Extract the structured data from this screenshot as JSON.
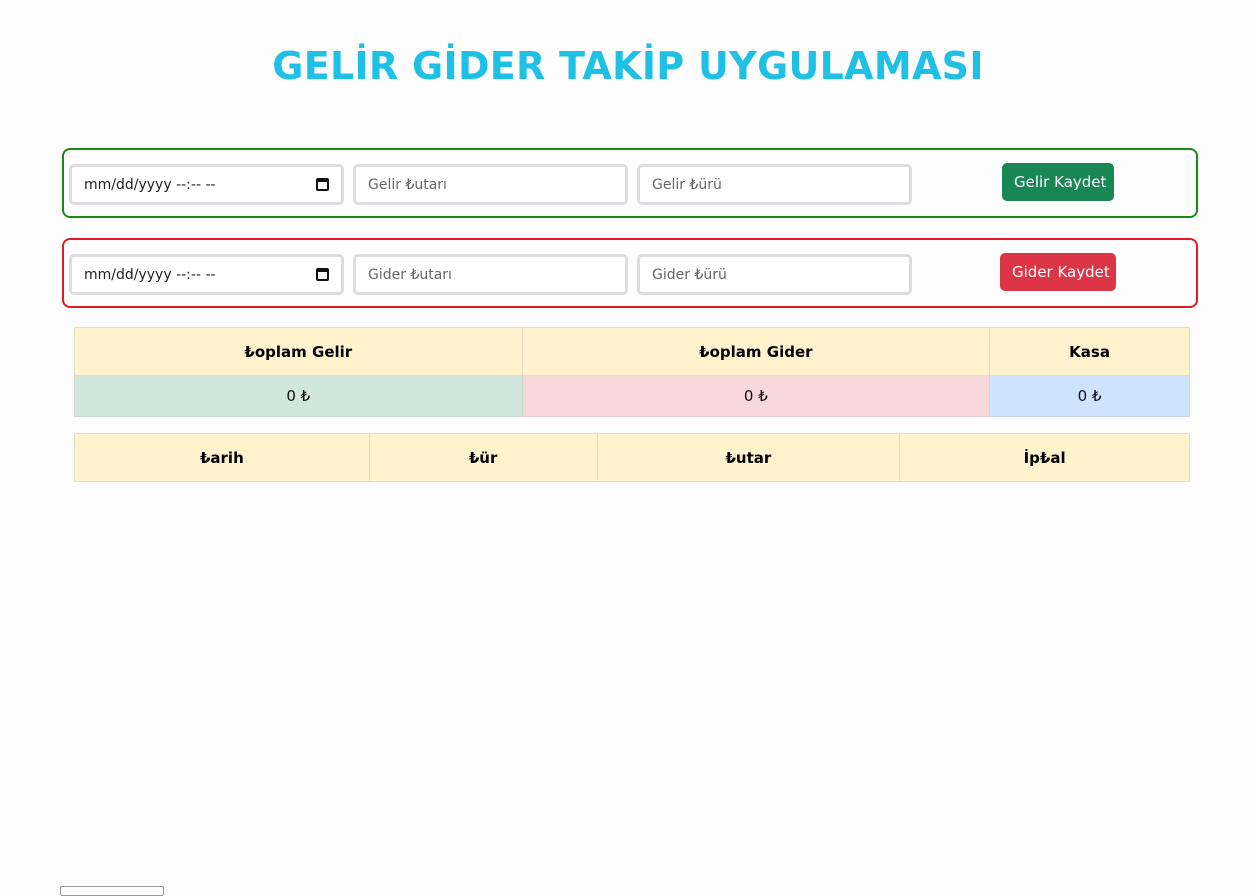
{
  "app": {
    "title": "GELİR GİDER TAKİP UYGULAMASI"
  },
  "income_form": {
    "date_placeholder": "mm/dd/yyyy --:-- --",
    "amount_placeholder": "Gelir ₺utarı",
    "type_placeholder": "Gelir ₺ürü",
    "submit_label": "Gelir Kaydet",
    "border_color": "#1a8a1a",
    "button_color": "#198754"
  },
  "expense_form": {
    "date_placeholder": "mm/dd/yyyy --:-- --",
    "amount_placeholder": "Gider ₺utarı",
    "type_placeholder": "Gider ₺ürü",
    "submit_label": "Gider Kaydet",
    "border_color": "#e31b23",
    "button_color": "#dc3545"
  },
  "summary": {
    "headers": [
      "₺oplam Gelir",
      "₺oplam Gider",
      "Kasa"
    ],
    "values": [
      "0 ₺",
      "0 ₺",
      "0 ₺"
    ]
  },
  "records": {
    "headers": [
      "₺arih",
      "₺ür",
      "₺utar",
      "İp₺al"
    ],
    "rows": []
  },
  "colors": {
    "title": "#1ec0e6",
    "header_bg": "#fff2cc",
    "income_bg": "#d1e7dd",
    "expense_bg": "#f8d7da",
    "cash_bg": "#cfe2ff"
  },
  "icons": {
    "date_picker": "calendar-icon"
  }
}
